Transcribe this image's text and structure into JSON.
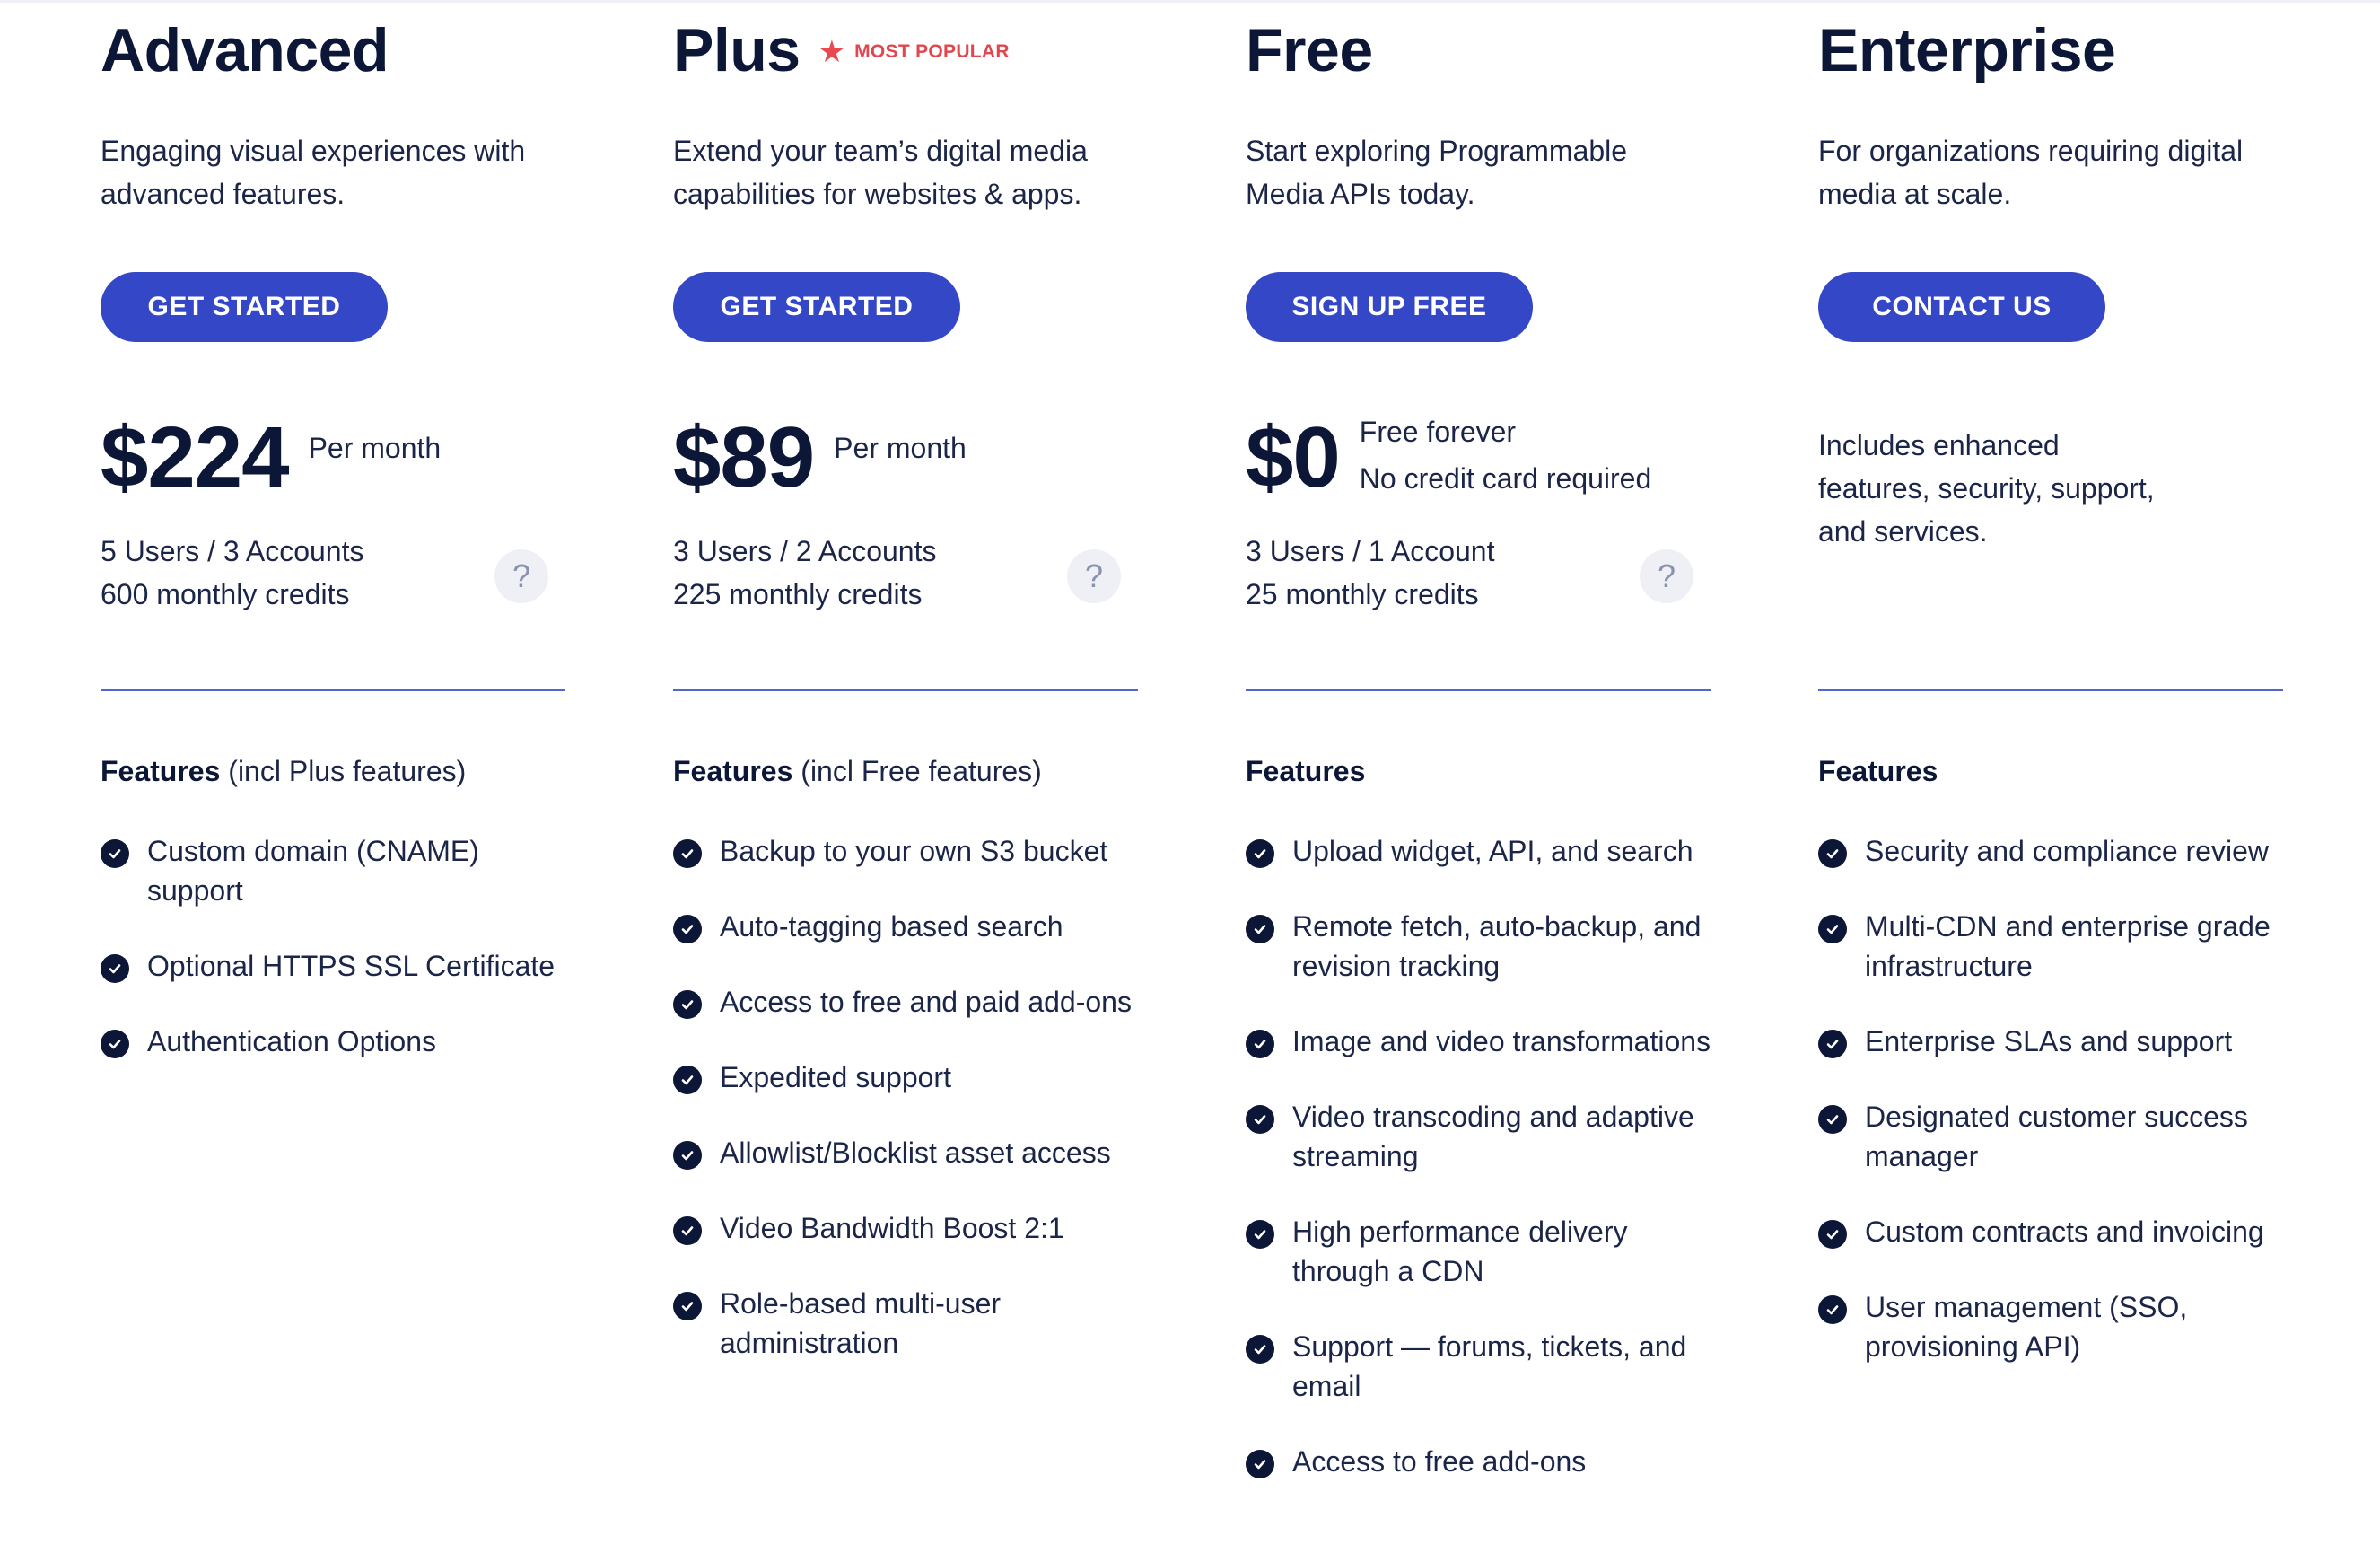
{
  "plans": [
    {
      "name": "Advanced",
      "badge": "",
      "description_lines": [
        "Engaging visual experiences with",
        "advanced features."
      ],
      "cta": "GET STARTED",
      "price": "$224",
      "price_note_lines": [
        "Per month"
      ],
      "limits_lines": [
        "5 Users / 3 Accounts",
        "600 monthly credits"
      ],
      "help_icon": "?",
      "features_heading": "Features",
      "features_heading_extra": " (incl Plus features)",
      "features": [
        "Custom domain (CNAME) support",
        "Optional HTTPS SSL Certificate",
        "Authentication Options"
      ]
    },
    {
      "name": "Plus",
      "badge": "MOST POPULAR",
      "badge_icon": "star-icon",
      "description_lines": [
        "Extend your team’s digital media",
        "capabilities for websites & apps."
      ],
      "cta": "GET STARTED",
      "price": "$89",
      "price_note_lines": [
        "Per month"
      ],
      "limits_lines": [
        "3 Users / 2 Accounts",
        "225 monthly credits"
      ],
      "help_icon": "?",
      "features_heading": "Features",
      "features_heading_extra": " (incl Free features)",
      "features": [
        "Backup to your own S3 bucket",
        "Auto-tagging based search",
        "Access to free and paid add-ons",
        "Expedited support",
        "Allowlist/Blocklist asset access",
        "Video Bandwidth Boost 2:1",
        "Role-based multi-user administration"
      ]
    },
    {
      "name": "Free",
      "badge": "",
      "description_lines": [
        "Start exploring Programmable",
        "Media APIs today."
      ],
      "cta": "SIGN UP FREE",
      "price": "$0",
      "price_note_lines": [
        "Free forever",
        "No credit card required"
      ],
      "limits_lines": [
        "3 Users / 1 Account",
        "25 monthly credits"
      ],
      "help_icon": "?",
      "features_heading": "Features",
      "features_heading_extra": "",
      "features": [
        "Upload widget, API, and search",
        "Remote fetch, auto-backup, and revision tracking",
        "Image and video transformations",
        "Video transcoding and adaptive streaming",
        "High performance delivery through a CDN",
        "Support — forums, tickets, and email",
        "Access to free add-ons"
      ]
    },
    {
      "name": "Enterprise",
      "badge": "",
      "description_lines": [
        "For organizations requiring digital",
        "media at scale."
      ],
      "cta": "CONTACT US",
      "enterprise_note_lines": [
        "Includes enhanced",
        "features, security, support,",
        "and services."
      ],
      "features_heading": "Features",
      "features_heading_extra": "",
      "features": [
        "Security and compliance review",
        "Multi-CDN and enterprise grade infrastructure",
        "Enterprise SLAs and support",
        "Designated customer success manager",
        "Custom contracts and invoicing",
        "User management (SSO, provisioning API)"
      ]
    }
  ],
  "colors": {
    "primary": "#3347c7",
    "heading": "#0c1637",
    "text": "#1b2548",
    "badge": "#e0474e",
    "divider": "#4f68c9"
  }
}
